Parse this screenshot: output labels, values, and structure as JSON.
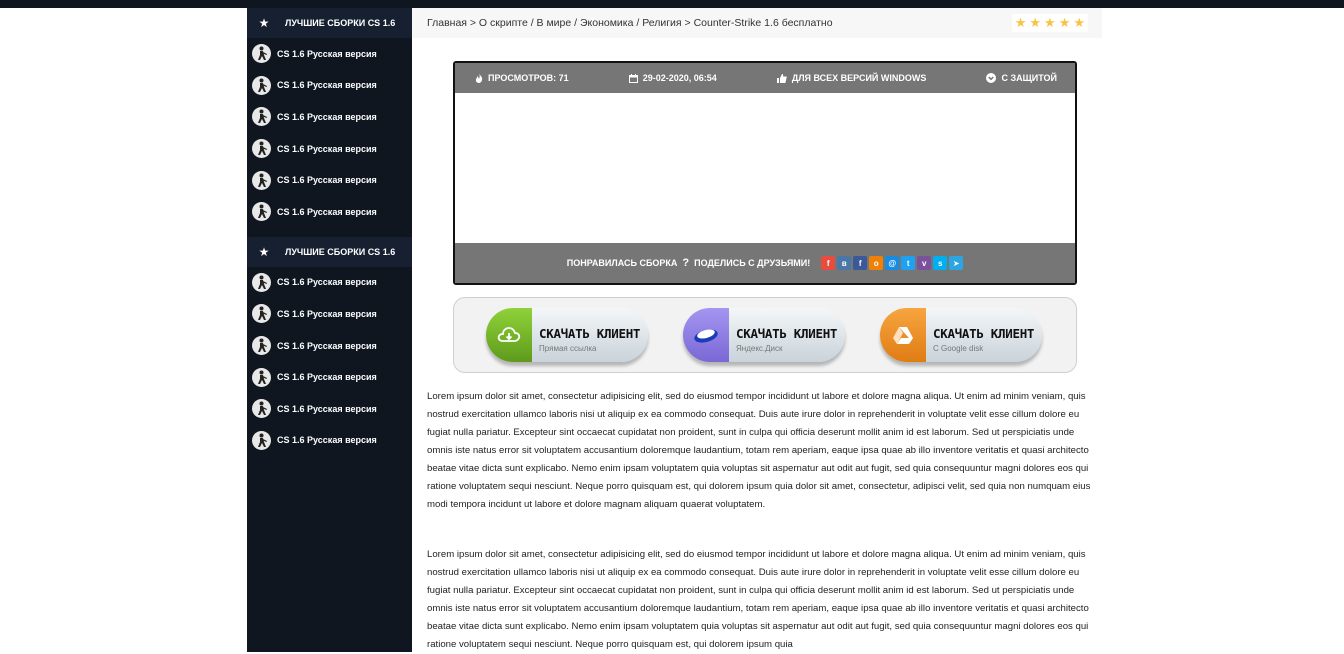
{
  "sidebar": {
    "sections": [
      {
        "title": "ЛУЧШИЕ СБОРКИ CS 1.6",
        "items": [
          "CS 1.6 Русская версия",
          "CS 1.6 Русская версия",
          "CS 1.6 Русская версия",
          "CS 1.6 Русская версия",
          "CS 1.6 Русская версия",
          "CS 1.6 Русская версия"
        ]
      },
      {
        "title": "ЛУЧШИЕ СБОРКИ CS 1.6",
        "items": [
          "CS 1.6 Русская версия",
          "CS 1.6 Русская версия",
          "CS 1.6 Русская версия",
          "CS 1.6 Русская версия",
          "CS 1.6 Русская версия",
          "CS 1.6 Русская версия"
        ]
      }
    ]
  },
  "breadcrumb": "Главная > О скрипте / В мире / Экономика / Религия > Counter-Strike 1.6 бесплатно",
  "rating": {
    "stars": 5,
    "color": "#f5c542"
  },
  "player": {
    "meta": {
      "views": "ПРОСМОТРОВ: 71",
      "date": "29-02-2020, 06:54",
      "compat": "ДЛЯ ВСЕХ ВЕРСИЙ WINDOWS",
      "protection": "С ЗАЩИТОЙ"
    },
    "share_text": "ПОНРАВИЛАСЬ СБОРКА",
    "share_text2": "ПОДЕЛИСЬ С ДРУЗЬЯМИ!"
  },
  "downloads": [
    {
      "title": "СКАЧАТЬ КЛИЕНТ",
      "subtitle": "Прямая ссылка",
      "color": "#7cb82f",
      "icon": "cloud-download-icon"
    },
    {
      "title": "СКАЧАТЬ КЛИЕНТ",
      "subtitle": "Яндекс.Диск",
      "color": "#8f7fe0",
      "icon": "yandex-disk-icon"
    },
    {
      "title": "СКАЧАТЬ КЛИЕНТ",
      "subtitle": "С Google disk",
      "color": "#f0922a",
      "icon": "google-drive-icon"
    }
  ],
  "paragraphs": [
    "Lorem ipsum dolor sit amet, consectetur adipisicing elit, sed do eiusmod tempor incididunt ut labore et dolore magna aliqua. Ut enim ad minim veniam, quis nostrud exercitation ullamco laboris nisi ut aliquip ex ea commodo consequat. Duis aute irure dolor in reprehenderit in voluptate velit esse cillum dolore eu fugiat nulla pariatur. Excepteur sint occaecat cupidatat non proident, sunt in culpa qui officia deserunt mollit anim id est laborum. Sed ut perspiciatis unde omnis iste natus error sit voluptatem accusantium doloremque laudantium, totam rem aperiam, eaque ipsa quae ab illo inventore veritatis et quasi architecto beatae vitae dicta sunt explicabo. Nemo enim ipsam voluptatem quia voluptas sit aspernatur aut odit aut fugit, sed quia consequuntur magni dolores eos qui ratione voluptatem sequi nesciunt. Neque porro quisquam est, qui dolorem ipsum quia dolor sit amet, consectetur, adipisci velit, sed quia non numquam eius modi tempora incidunt ut labore et dolore magnam aliquam quaerat voluptatem.",
    "Lorem ipsum dolor sit amet, consectetur adipisicing elit, sed do eiusmod tempor incididunt ut labore et dolore magna aliqua. Ut enim ad minim veniam, quis nostrud exercitation ullamco laboris nisi ut aliquip ex ea commodo consequat. Duis aute irure dolor in reprehenderit in voluptate velit esse cillum dolore eu fugiat nulla pariatur. Excepteur sint occaecat cupidatat non proident, sunt in culpa qui officia deserunt mollit anim id est laborum. Sed ut perspiciatis unde omnis iste natus error sit voluptatem accusantium doloremque laudantium, totam rem aperiam, eaque ipsa quae ab illo inventore veritatis et quasi architecto beatae vitae dicta sunt explicabo. Nemo enim ipsam voluptatem quia voluptas sit aspernatur aut odit aut fugit, sed quia consequuntur magni dolores eos qui ratione voluptatem sequi nesciunt. Neque porro quisquam est, qui dolorem ipsum quia"
  ]
}
